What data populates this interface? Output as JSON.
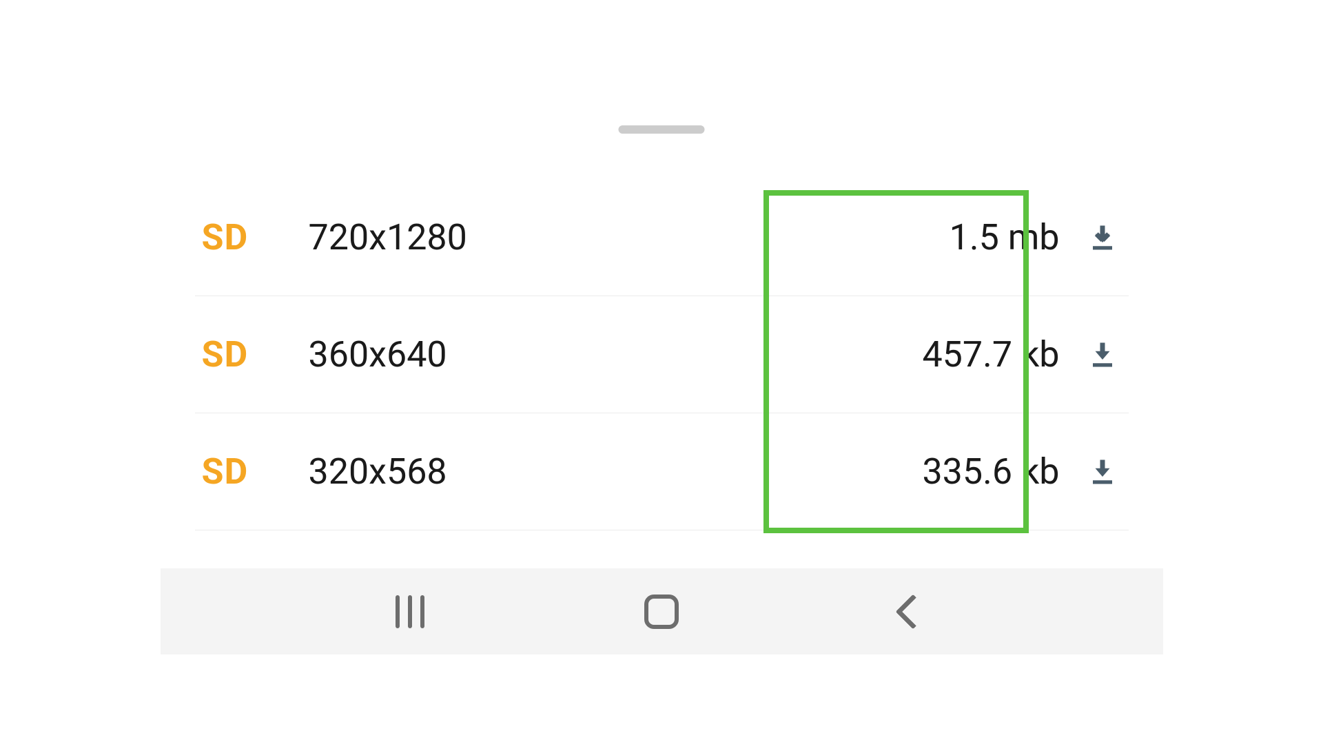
{
  "colors": {
    "badge": "#f5a623",
    "highlight": "#5cc23f",
    "text": "#1a1a1a",
    "nav_icon": "#6d6d6d"
  },
  "download_options": [
    {
      "quality": "SD",
      "resolution": "720x1280",
      "size": "1.5 mb"
    },
    {
      "quality": "SD",
      "resolution": "360x640",
      "size": "457.7 kb"
    },
    {
      "quality": "SD",
      "resolution": "320x568",
      "size": "335.6 kb"
    }
  ]
}
